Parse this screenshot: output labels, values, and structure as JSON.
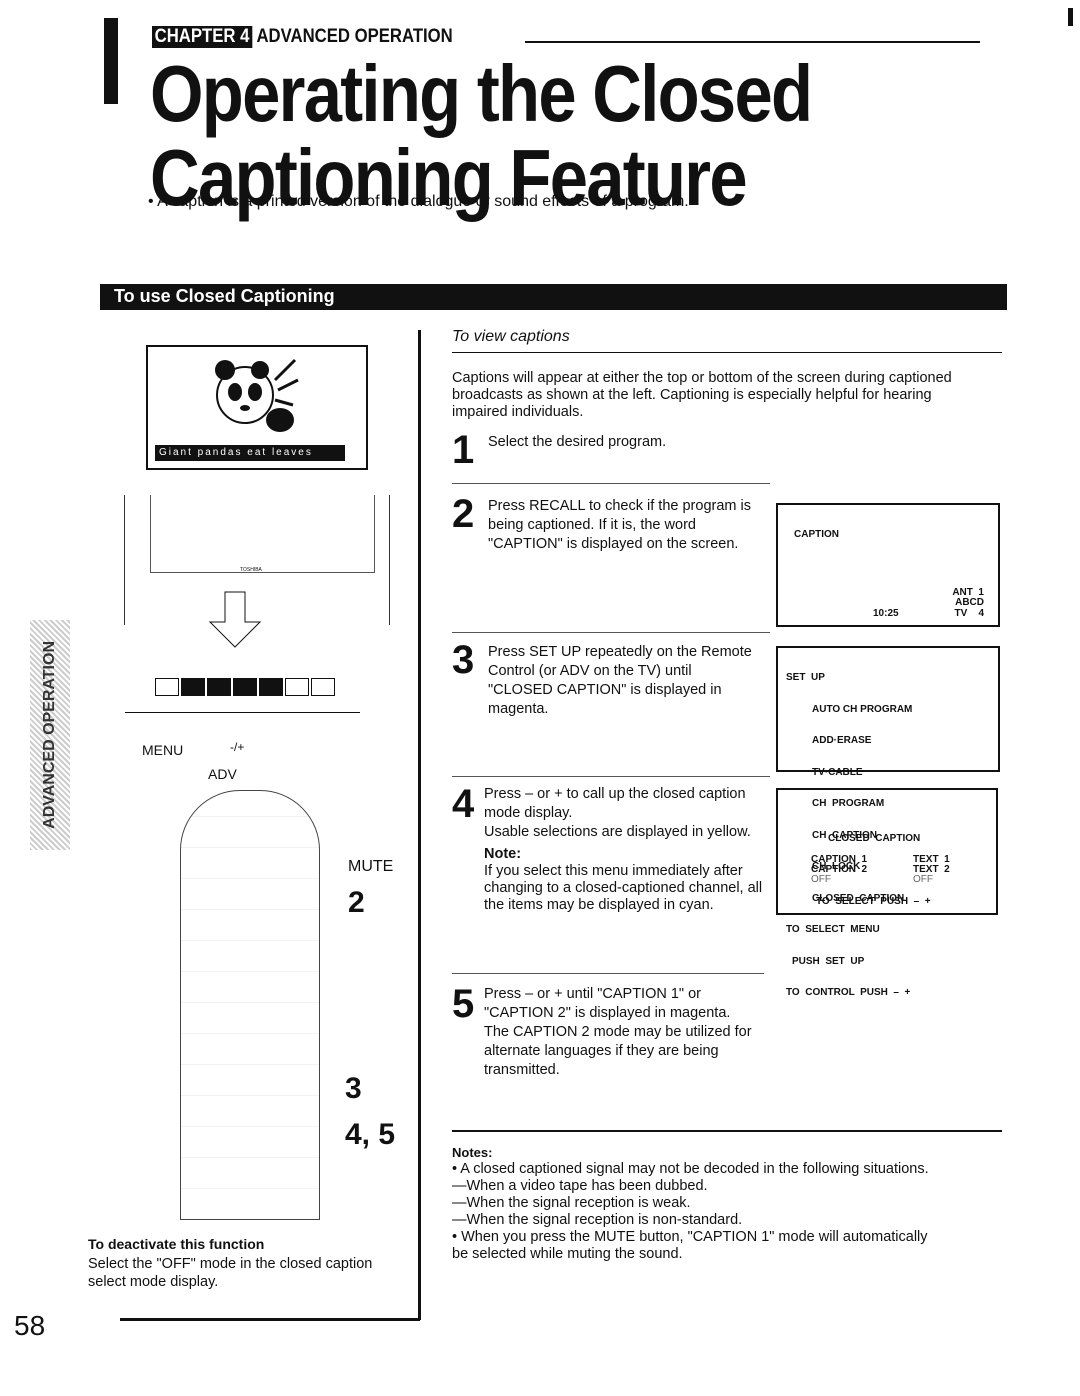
{
  "header": {
    "chapter_tag": "CHAPTER 4",
    "chapter_title": "ADVANCED OPERATION",
    "title_line1": "Operating the Closed",
    "title_line2": "Captioning Feature",
    "intro": "• A caption is a printed version of the dialogue or sound effects of a program."
  },
  "section_title": "To use Closed Captioning",
  "side_tab": "ADVANCED OPERATION",
  "page_number": "58",
  "illustration": {
    "caption_band": "Giant pandas eat leaves",
    "brand": "TOSHIBA",
    "menu_label": "MENU",
    "plusminus_label": "-/+",
    "adv_label": "ADV",
    "mute_label": "MUTE",
    "callouts": [
      "2",
      "3",
      "4, 5"
    ]
  },
  "deactivate": {
    "heading": "To deactivate this function",
    "text": "Select the \"OFF\" mode in the closed caption select mode display."
  },
  "view": {
    "heading": "To view captions",
    "intro": "Captions will appear at either the top or bottom of the screen during captioned broadcasts as shown at the left. Captioning is especially helpful for hearing impaired individuals.",
    "steps": [
      {
        "n": "1",
        "text": "Select the desired program."
      },
      {
        "n": "2",
        "text": "Press RECALL to check if the program is being captioned. If it is, the word \"CAPTION\" is displayed on the screen."
      },
      {
        "n": "3",
        "text": "Press SET UP repeatedly on the Remote Control (or ADV on the TV) until \"CLOSED CAPTION\" is displayed in magenta."
      },
      {
        "n": "4",
        "text": "Press – or + to call up the closed caption mode display.",
        "text2": "Usable selections are displayed in yellow.",
        "note_label": "Note:",
        "note": "If you select this menu immediately after changing to a closed-captioned channel, all the items may be displayed in cyan."
      },
      {
        "n": "5",
        "text": "Press – or + until \"CAPTION 1\" or \"CAPTION 2\" is displayed in magenta.",
        "text2": "The CAPTION 2 mode may be utilized for alternate languages if they are being transmitted."
      }
    ]
  },
  "osd1": {
    "caption": "CAPTION",
    "ant": "ANT  1",
    "abcd": "ABCD",
    "time": "10:25",
    "tv": "TV    4"
  },
  "osd2": {
    "lines": [
      "SET  UP",
      "AUTO CH PROGRAM",
      "ADD·ERASE",
      "TV·CABLE",
      "CH  PROGRAM",
      "CH  CAPTION",
      "CH  LOCK",
      "CLOSED  CAPTION",
      "TO  SELECT  MENU",
      "PUSH  SET  UP",
      "TO  CONTROL  PUSH  –  +"
    ]
  },
  "osd3": {
    "title": "CLOSED  CAPTION",
    "c1": "CAPTION  1",
    "c2": "CAPTION  2",
    "off1": "OFF",
    "t1": "TEXT  1",
    "t2": "TEXT  2",
    "off2": "OFF",
    "footer": "TO  SELECT  PUSH  –  +"
  },
  "notes": {
    "heading": "Notes:",
    "items": [
      "• A closed captioned signal may not be decoded in the following situations.",
      "—When a video tape has been dubbed.",
      "—When the signal reception is weak.",
      "—When the signal reception is non-standard.",
      "• When you press the MUTE button, \"CAPTION 1\" mode will automatically be selected while muting the sound."
    ]
  }
}
